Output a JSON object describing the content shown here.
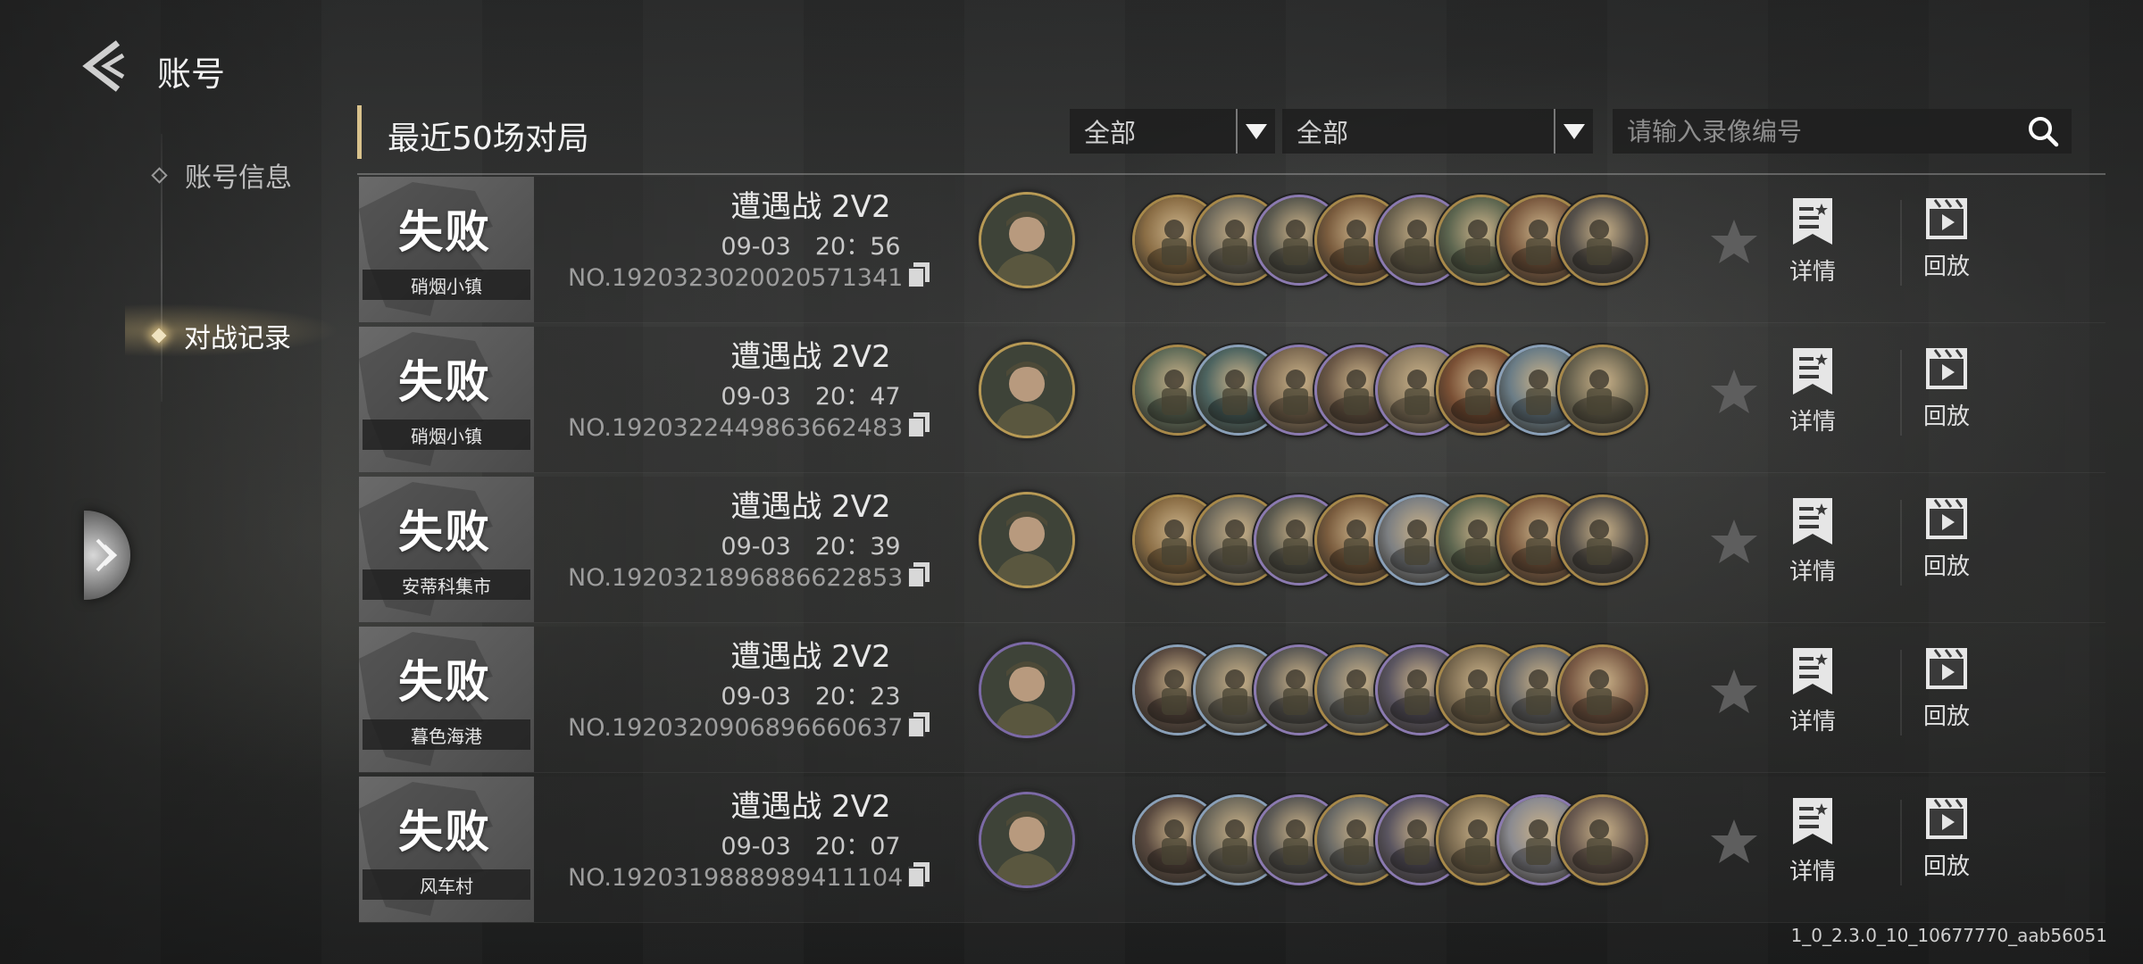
{
  "header": {
    "title": "账号"
  },
  "sidebar": {
    "items": [
      {
        "label": "账号信息",
        "active": false
      },
      {
        "label": "对战记录",
        "active": true
      }
    ]
  },
  "main": {
    "section_title": "最近50场对局",
    "filters": [
      {
        "value": "全部"
      },
      {
        "value": "全部"
      }
    ],
    "search": {
      "placeholder": "请输入录像编号"
    }
  },
  "actions": {
    "detail_label": "详情",
    "replay_label": "回放"
  },
  "matches": [
    {
      "result": "失败",
      "map": "硝烟小镇",
      "mode": "遭遇战 2V2",
      "time": "09-03　20：56",
      "match_no": "NO.19203230200205713​41",
      "commander_frame": "gold"
    },
    {
      "result": "失败",
      "map": "硝烟小镇",
      "mode": "遭遇战 2V2",
      "time": "09-03　20：47",
      "match_no": "NO.1920322449863662483",
      "commander_frame": "gold"
    },
    {
      "result": "失败",
      "map": "安蒂科集市",
      "mode": "遭遇战 2V2",
      "time": "09-03　20：39",
      "match_no": "NO.1920321896886622853",
      "commander_frame": "gold"
    },
    {
      "result": "失败",
      "map": "暮色海港",
      "mode": "遭遇战 2V2",
      "time": "09-03　20：23",
      "match_no": "NO.1920320906896660637",
      "commander_frame": "purple"
    },
    {
      "result": "失败",
      "map": "风车村",
      "mode": "遭遇战 2V2",
      "time": "09-03　20：07",
      "match_no": "NO.1920319888989411104",
      "commander_frame": "purple"
    }
  ],
  "colors": {
    "accent_gold": "#d9c28c",
    "result_block": "#5a5a5a"
  },
  "icons": [
    "back-arrow-icon",
    "search-icon",
    "dropdown-arrow-icon",
    "copy-icon",
    "star-icon",
    "bookmark-star-icon",
    "film-play-icon",
    "expand-chevron-icon"
  ],
  "version": "1_0_2.3.0_10_10677770_aab56051"
}
